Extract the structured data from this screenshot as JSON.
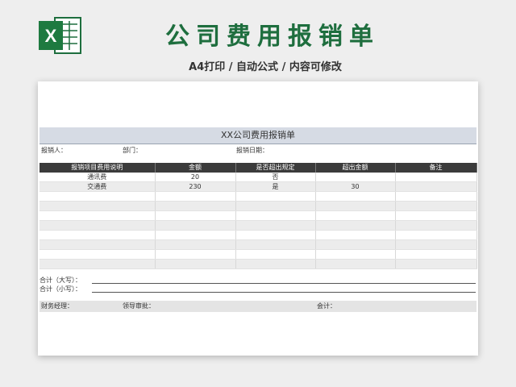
{
  "header": {
    "title": "公司费用报销单",
    "subtitle": "A4打印 / 自动公式 / 内容可修改",
    "icon_letter": "X"
  },
  "form": {
    "title": "XX公司费用报销单",
    "applicant_label": "报销人：",
    "department_label": "部门：",
    "date_label": "报销日期："
  },
  "table": {
    "columns": [
      "报销项目费用说明",
      "金额",
      "是否超出规定",
      "超出金额",
      "备注"
    ],
    "rows": [
      [
        "通讯费",
        "20",
        "否",
        "",
        ""
      ],
      [
        "交通费",
        "230",
        "是",
        "30",
        ""
      ],
      [
        "",
        "",
        "",
        "",
        ""
      ],
      [
        "",
        "",
        "",
        "",
        ""
      ],
      [
        "",
        "",
        "",
        "",
        ""
      ],
      [
        "",
        "",
        "",
        "",
        ""
      ],
      [
        "",
        "",
        "",
        "",
        ""
      ],
      [
        "",
        "",
        "",
        "",
        ""
      ],
      [
        "",
        "",
        "",
        "",
        ""
      ],
      [
        "",
        "",
        "",
        "",
        ""
      ]
    ]
  },
  "totals": {
    "uppercase_label": "合计（大写）：",
    "lowercase_label": "合计（小写）："
  },
  "footer": {
    "finance_manager_label": "财务经理：",
    "leader_approval_label": "领导审批：",
    "accountant_label": "会计："
  },
  "colors": {
    "brand_green": "#1e6e3e",
    "title_bar": "#d6dbe4",
    "table_header": "#3b3b3b"
  }
}
